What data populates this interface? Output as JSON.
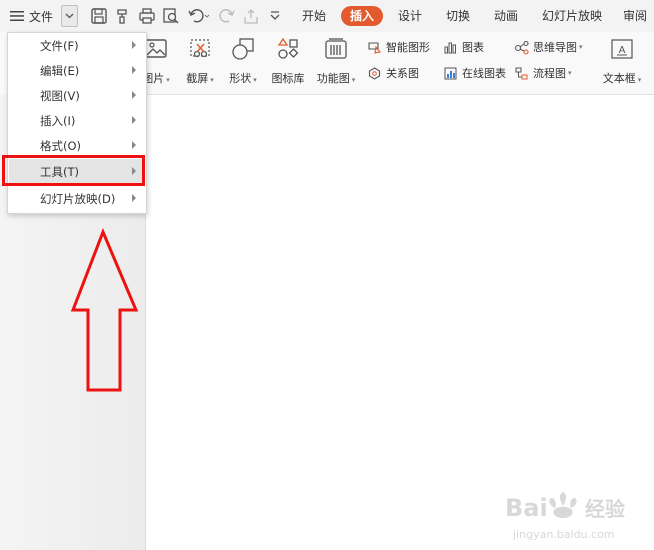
{
  "topbar": {
    "file_menu_label": "文件",
    "tabs": [
      {
        "label": "开始",
        "active": false
      },
      {
        "label": "插入",
        "active": true
      },
      {
        "label": "设计",
        "active": false
      },
      {
        "label": "切换",
        "active": false
      },
      {
        "label": "动画",
        "active": false
      },
      {
        "label": "幻灯片放映",
        "active": false
      },
      {
        "label": "审阅",
        "active": false
      }
    ]
  },
  "ribbon": {
    "picture": "图片",
    "screenshot": "截屏",
    "shapes": "形状",
    "icon_library": "图标库",
    "function_chart": "功能图",
    "smart_art": "智能图形",
    "chart": "图表",
    "relation_chart": "关系图",
    "online_chart": "在线图表",
    "mind_map": "思维导图",
    "flowchart": "流程图",
    "textbox": "文本框"
  },
  "dropdown": {
    "items": [
      {
        "label": "文件(F)"
      },
      {
        "label": "编辑(E)"
      },
      {
        "label": "视图(V)"
      },
      {
        "label": "插入(I)"
      },
      {
        "label": "格式(O)"
      },
      {
        "label": "工具(T)"
      },
      {
        "label": "幻灯片放映(D)"
      }
    ]
  },
  "left_pane": {
    "links": "...................."
  },
  "watermark": {
    "brand": "Bai",
    "brand2": "经验",
    "domain": "jingyan.baidu.com"
  },
  "colors": {
    "accent": "#e35a2e",
    "highlight_red": "#ee1111",
    "icon_gray": "#555555"
  }
}
